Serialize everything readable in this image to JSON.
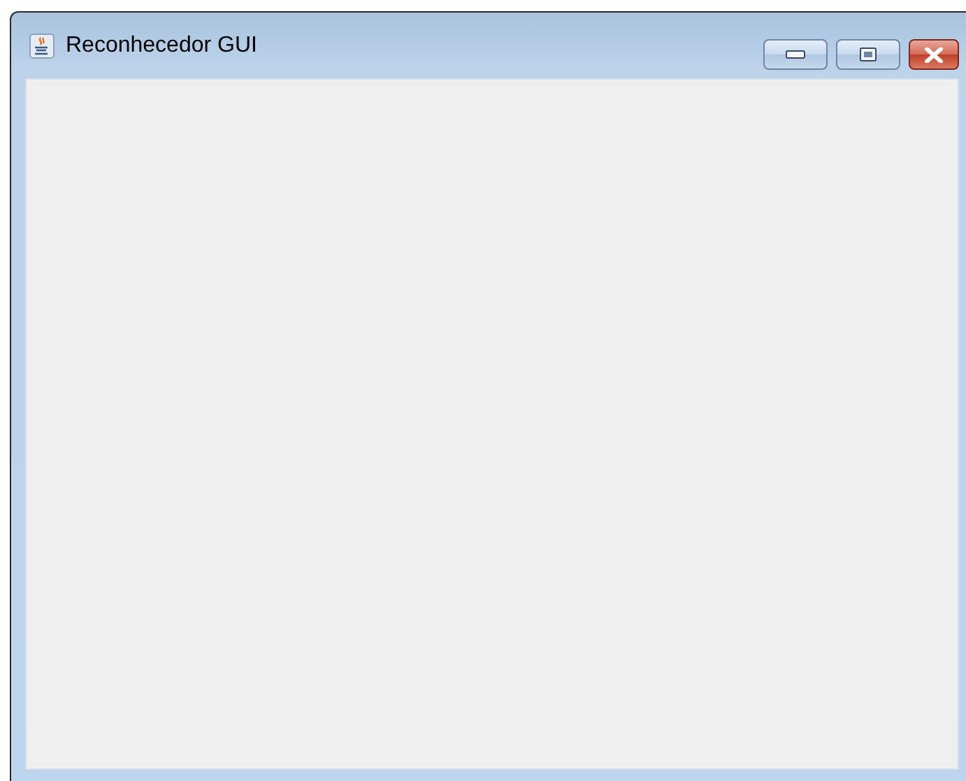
{
  "window": {
    "title": "Reconhecedor GUI"
  }
}
